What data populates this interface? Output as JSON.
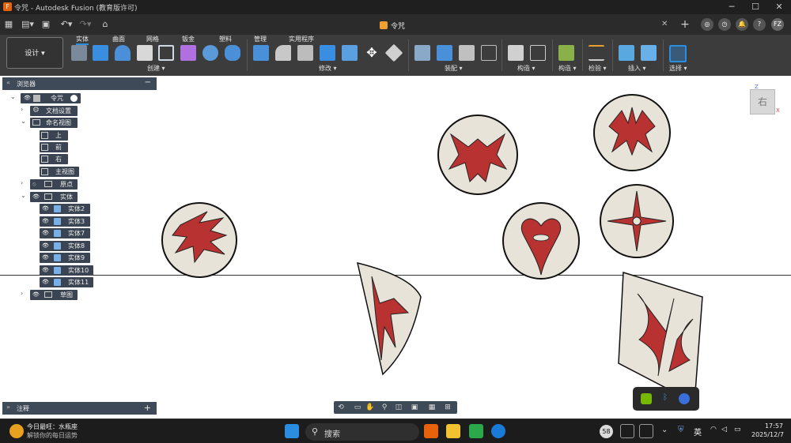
{
  "window": {
    "title": "令咒 - Autodesk Fusion (教育版许可)",
    "doc_tab": "令咒",
    "user_initials": "FZ"
  },
  "ribbon": {
    "workspace": "设计",
    "tabs": [
      "实体",
      "曲面",
      "网格",
      "钣金",
      "塑料",
      "管理",
      "实用程序"
    ],
    "active_tab": "实体",
    "groups": {
      "create": "创建",
      "modify": "修改",
      "assemble": "装配",
      "construct": "构造",
      "inspect": "检验",
      "insert": "插入",
      "select": "选择"
    }
  },
  "browser": {
    "title": "浏览器",
    "root": "令咒",
    "items": {
      "doc_settings": "文档设置",
      "named_views": "命名视图",
      "view_top": "上",
      "view_front": "前",
      "view_right": "右",
      "view_home": "主视图",
      "origin": "原点",
      "bodies": "实体",
      "body2": "实体2",
      "body3": "实体3",
      "body7": "实体7",
      "body8": "实体8",
      "body9": "实体9",
      "body10": "实体10",
      "body11": "实体11",
      "sketches": "草图"
    }
  },
  "notes": {
    "label": "注释"
  },
  "viewcube": {
    "face": "右",
    "axis_z": "Z",
    "axis_x": "X"
  },
  "taskbar": {
    "weather_line1": "今日最旺：水瓶座",
    "weather_line2": "解锁你的每日运势",
    "search_placeholder": "搜索",
    "badge": "58",
    "ime": "英",
    "time": "17:57",
    "date": "2025/12/7"
  },
  "colors": {
    "accent": "#2a8de0",
    "token_fill": "#e7e3d8",
    "glyph_red": "#b83232",
    "panel": "#3f4a58"
  }
}
